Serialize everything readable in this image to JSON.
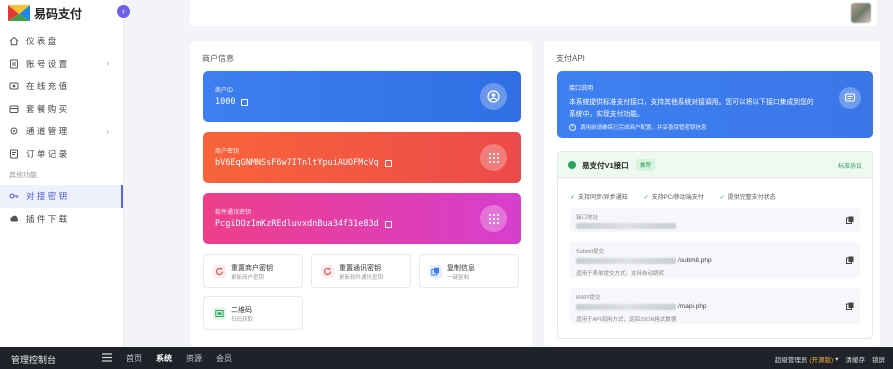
{
  "app": {
    "logo_text": "易码支付"
  },
  "sidebar": {
    "items": [
      {
        "label": "仪 表 盘",
        "icon": "home-icon"
      },
      {
        "label": "账 号 设 置",
        "icon": "account-icon",
        "has_arrow": true
      },
      {
        "label": "在 线 充 值",
        "icon": "recharge-icon"
      },
      {
        "label": "套 餐 购 买",
        "icon": "package-icon"
      },
      {
        "label": "通 道 管 理",
        "icon": "channel-icon",
        "has_arrow": true
      },
      {
        "label": "订 单 记 录",
        "icon": "order-icon"
      }
    ],
    "section_label": "其他功能",
    "other_items": [
      {
        "label": "对 接 密 钥",
        "icon": "key-icon",
        "active": true
      },
      {
        "label": "插 件 下 载",
        "icon": "download-icon"
      }
    ]
  },
  "merchant": {
    "title": "商户信息",
    "id_label": "商户ID",
    "id_value": "1000",
    "secret_label": "商户密钥",
    "secret_value": "bV6EqGNMNSsF6w7ITnltYpuiAUOFMcVq",
    "comm_label": "软件通讯密钥",
    "comm_value": "PcgiDOzImKzREdluvxdnBua34f31e83d",
    "actions": [
      {
        "title": "重置商户密钥",
        "sub": "更新商户密钥"
      },
      {
        "title": "重置通讯密钥",
        "sub": "更新软件通讯密钥"
      },
      {
        "title": "复制信息",
        "sub": "一键复制"
      },
      {
        "title": "二维码",
        "sub": "扫码获取"
      }
    ]
  },
  "api": {
    "title": "支付API",
    "info_head": "接口说明",
    "info_text": "本系统提供标准支付接口，支持其他系统对接调用。您可以将以下接口集成到您的系统中，实现支付功能。",
    "info_note": "调用前请确保已完成商户配置，并妥善保管密钥信息",
    "box_title": "易支付V1接口",
    "box_tag": "推荐",
    "box_std": "标准协议",
    "features": [
      "支持同步/异步通知",
      "支持PC/移动端支付",
      "提供完整支付状态"
    ],
    "rows": [
      {
        "label": "接口地址",
        "url_suffix": "",
        "desc": ""
      },
      {
        "label": "Submit提交",
        "url_suffix": "/submit.php",
        "desc": "适用于表单提交方式，支持自动跳转"
      },
      {
        "label": "MAPI提交",
        "url_suffix": "/mapi.php",
        "desc": "适用于API调用方式，返回JSON格式数据"
      }
    ]
  },
  "bottombar": {
    "title": "管理控制台",
    "nav": [
      "首页",
      "系统",
      "资源",
      "会员"
    ],
    "active_nav": "系统",
    "user": "超级管理员",
    "opensrc": "(开源版)",
    "clear_cache": "清缓存",
    "lock": "锁屏"
  },
  "colors": {
    "accent": "#5b63e6",
    "blue": "#3e7ff0",
    "orange": "#f7643a",
    "pink": "#ee3f8a",
    "green": "#26a65b"
  }
}
